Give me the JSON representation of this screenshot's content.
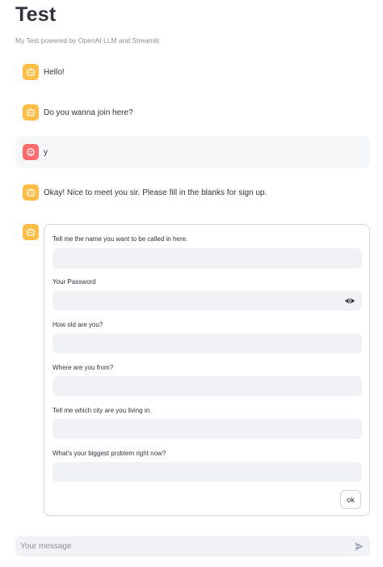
{
  "header": {
    "title": "Test",
    "subtitle": "My Test powered by OpenAI LLM and Streamlit"
  },
  "messages": [
    {
      "role": "assistant",
      "text": "Hello!",
      "avatar_icon": "bot-icon"
    },
    {
      "role": "assistant",
      "text": "Do you wanna join here?",
      "avatar_icon": "bot-icon"
    },
    {
      "role": "user",
      "text": "y",
      "avatar_icon": "user-icon"
    },
    {
      "role": "assistant",
      "text": "Okay! Nice to meet you sir. Please fill in the blanks for sign up.",
      "avatar_icon": "bot-icon"
    }
  ],
  "form": {
    "fields": [
      {
        "label": "Tell me the name you want to be called in here.",
        "value": ""
      },
      {
        "label": "Your Password",
        "value": "",
        "icon": "eye-icon"
      },
      {
        "label": "How old are you?",
        "value": ""
      },
      {
        "label": "Where are you from?",
        "value": ""
      },
      {
        "label": "Tell me which city are you living in.",
        "value": ""
      },
      {
        "label": "What's your biggest problem right now?",
        "value": ""
      }
    ],
    "submit_label": "ok"
  },
  "chat_input": {
    "placeholder": "Your message",
    "send_icon": "send-icon"
  },
  "colors": {
    "assistant_avatar": "#ffbd45",
    "user_avatar": "#ff6b6b",
    "input_bg": "#f0f2f6",
    "user_msg_bg": "#f6f7f9"
  }
}
